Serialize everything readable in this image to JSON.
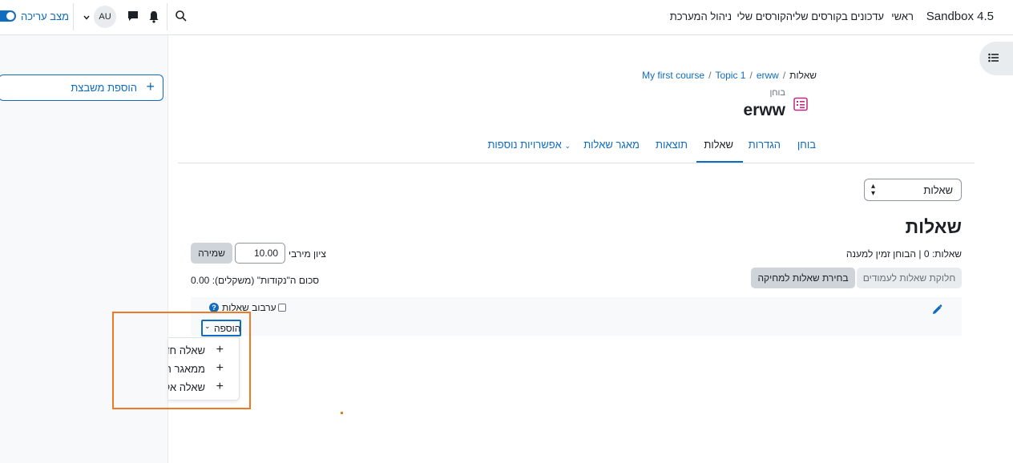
{
  "topnav": {
    "brand": "Sandbox 4.5",
    "links": [
      "ראשי",
      "עדכונים בקורסים שלי",
      "הקורסים שלי",
      "ניהול המערכת"
    ],
    "avatar": "AU",
    "edit_mode_label": "מצב עריכה"
  },
  "left_drawer": {
    "add_block_label": "הוספת משבצת"
  },
  "breadcrumb": [
    "My first course",
    "Topic 1",
    "erww",
    "שאלות"
  ],
  "header": {
    "subtitle": "בוחן",
    "title": "erww"
  },
  "tabs": [
    "בוחן",
    "הגדרות",
    "שאלות",
    "תוצאות",
    "מאגר שאלות",
    "אפשרויות נוספות"
  ],
  "tab_active_index": 2,
  "view_select": {
    "value": "שאלות"
  },
  "main": {
    "heading": "שאלות",
    "summary": "שאלות: 0 | הבוחן זמין למענה",
    "max_grade_label": "ציון מירבי",
    "max_grade_value": "10.00",
    "save_label": "שמירה",
    "sum_label": "סכום ה\"נקודות\" (משקלים): 0.00",
    "repaginate_label": "חלוקת שאלות לעמודים",
    "select_multiple_label": "בחירת שאלות למחיקה",
    "shuffle_label": "ערבוב שאלות",
    "add_label": "הוספה"
  },
  "add_menu": [
    "שאלה חדשה",
    "ממאגר השאלות",
    "שאלה אקראית"
  ],
  "colors": {
    "accent": "#0f6cbf",
    "highlight": "#f07a24",
    "quiz_icon": "#c02781"
  }
}
